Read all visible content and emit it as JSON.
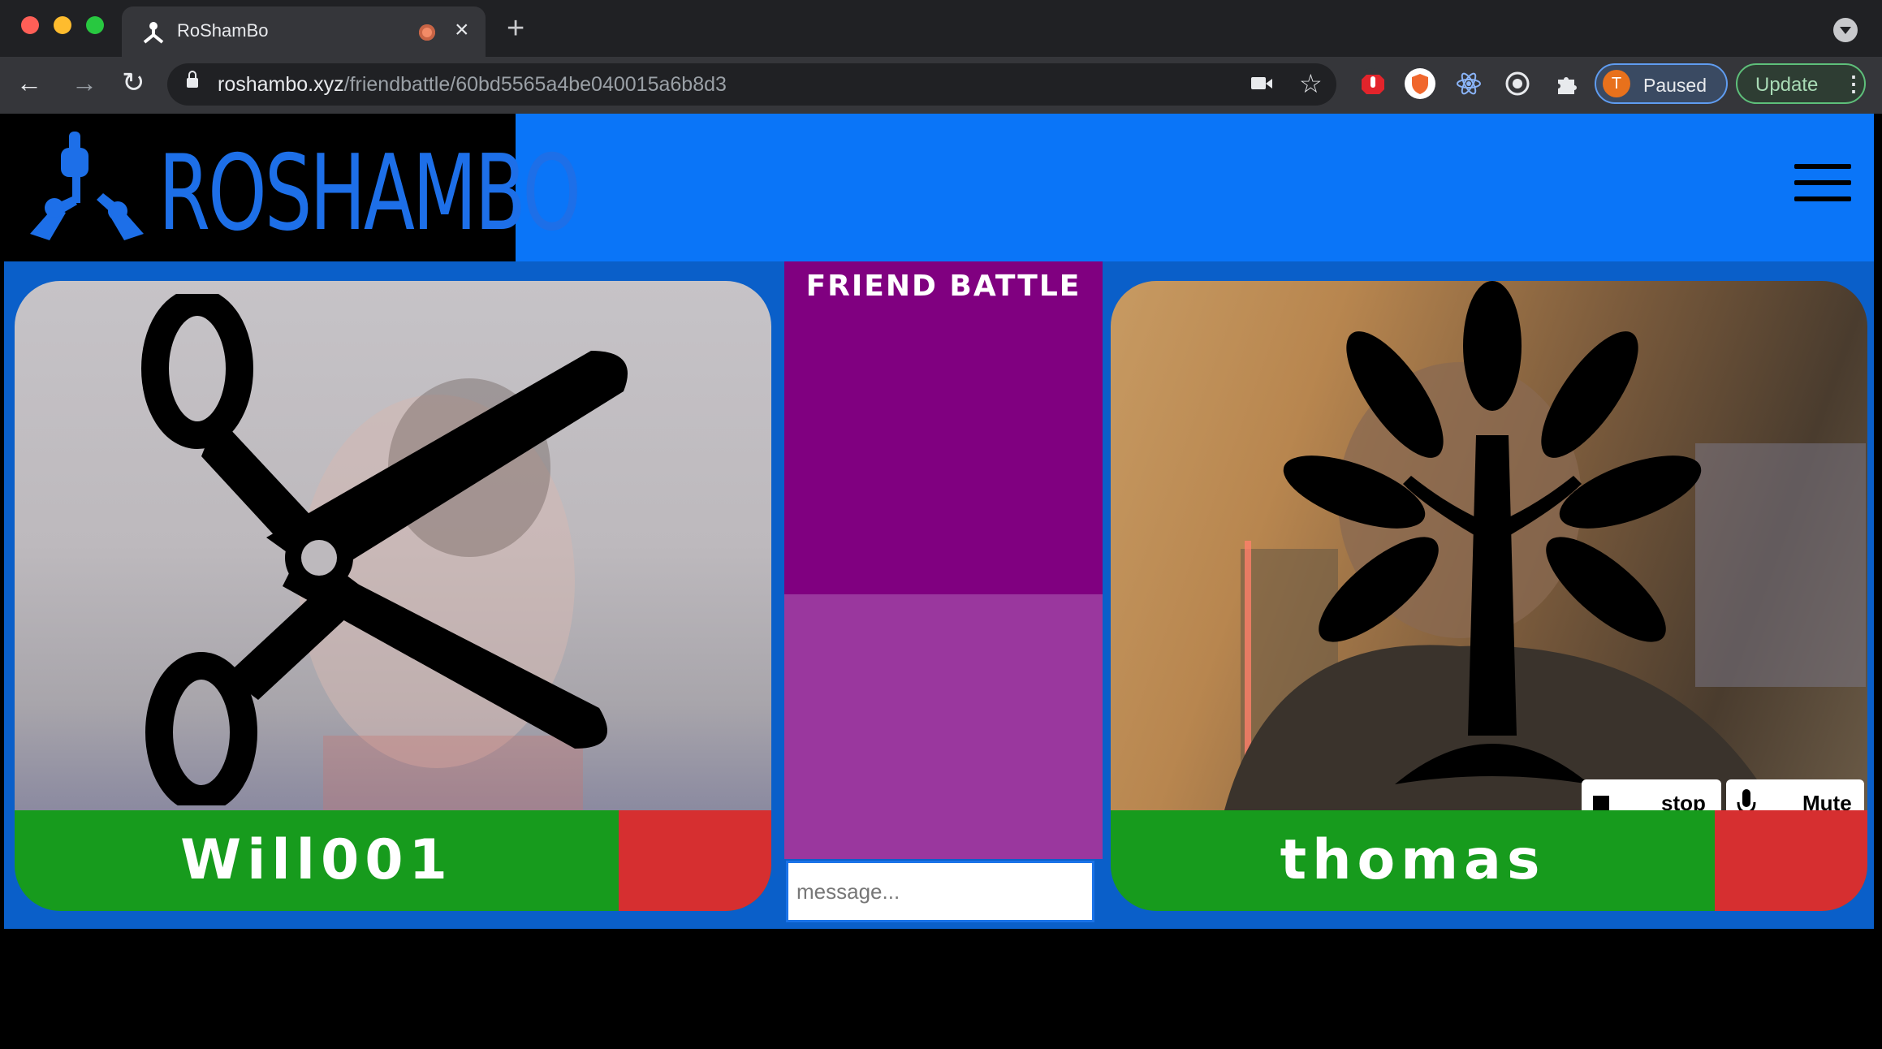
{
  "browser": {
    "tab_title": "RoShamBo",
    "tab_close": "×",
    "new_tab": "+",
    "url_host": "roshambo.xyz",
    "url_path": "/friendbattle/60bd5565a4be040015a6b8d3",
    "profile_initial": "T",
    "profile_label": "Paused",
    "update_label": "Update",
    "back": "←",
    "forward": "→",
    "reload": "↻",
    "star": "☆",
    "menu": "⋮"
  },
  "header": {
    "logo_text": "ROSHAMBO"
  },
  "battle": {
    "title": "FRIEND BATTLE",
    "message_placeholder": "message..."
  },
  "players": [
    {
      "name": "Will001",
      "move_icon": "scissors-icon"
    },
    {
      "name": "thomas",
      "move_icon": "paper-tree-icon"
    }
  ],
  "video_controls": {
    "stop_label": "stop",
    "mute_label": "Mute"
  },
  "colors": {
    "header_blue": "#0a75f8",
    "arena_blue": "#0a5fc9",
    "chat_purple": "#800080",
    "chat_purple_light": "#9a379e",
    "name_bar_green": "#179b1d",
    "name_bar_red": "#d62f30"
  }
}
